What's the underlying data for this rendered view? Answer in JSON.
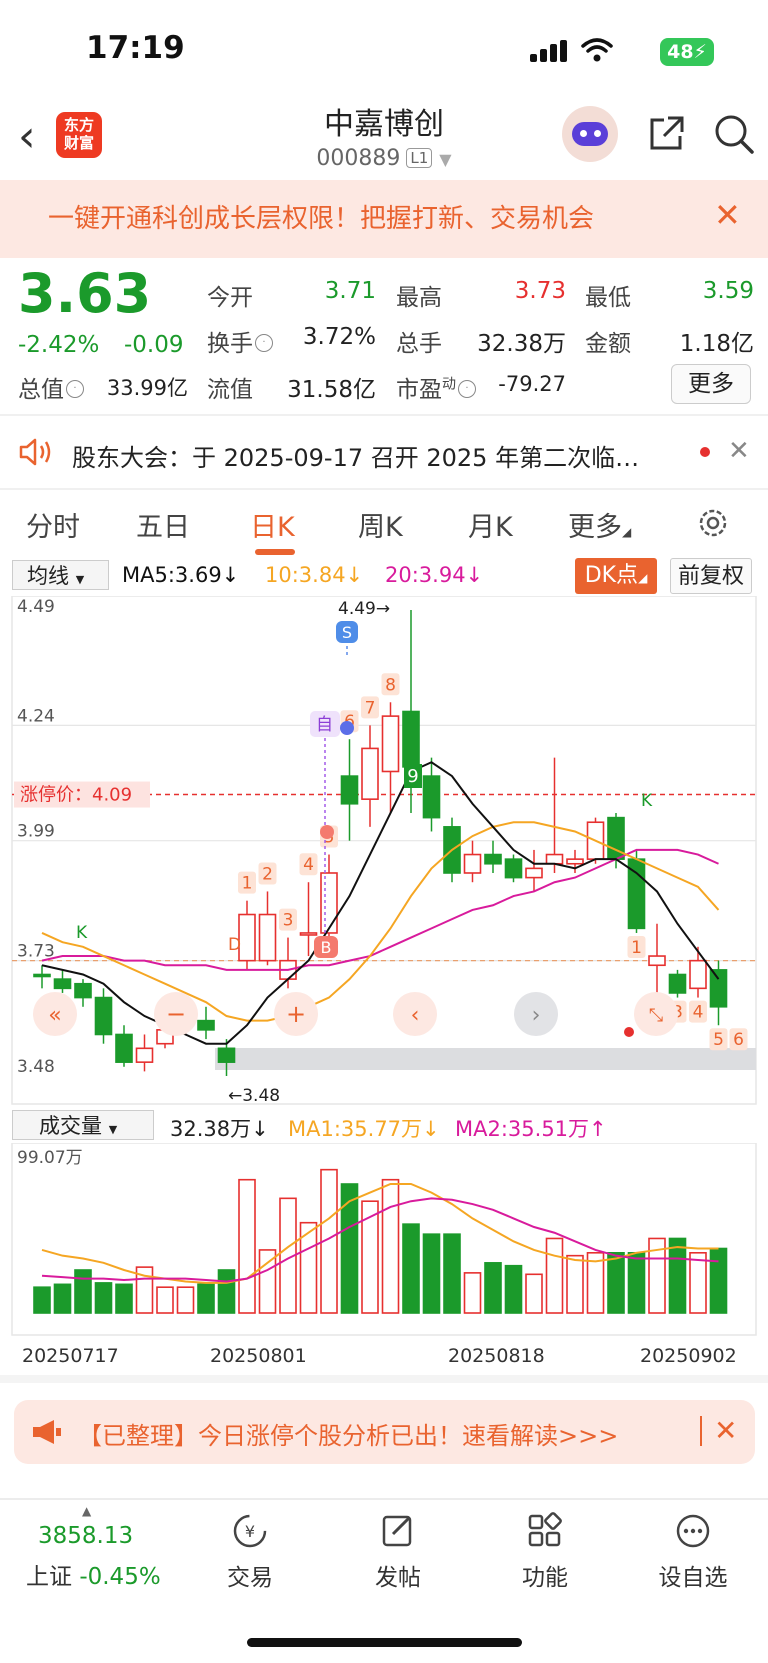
{
  "status": {
    "time": "17:19",
    "battery": "48"
  },
  "header": {
    "name": "中嘉博创",
    "code": "000889",
    "level": "L1",
    "logo": "东方\n财富"
  },
  "promo": {
    "text": "一键开通科创成长层权限！把握打新、交易机会"
  },
  "quote": {
    "price": "3.63",
    "change_pct": "-2.42%",
    "change": "-0.09",
    "open_label": "今开",
    "open": "3.71",
    "high_label": "最高",
    "high": "3.73",
    "low_label": "最低",
    "low": "3.59",
    "turnover_label": "换手",
    "turnover": "3.72%",
    "volume_label": "总手",
    "volume": "32.38万",
    "amount_label": "金额",
    "amount": "1.18亿",
    "mktcap_label": "总值",
    "mktcap": "33.99亿",
    "float_label": "流值",
    "float": "31.58亿",
    "pe_label": "市盈",
    "pe_sup": "动",
    "pe": "-79.27",
    "more": "更多"
  },
  "notice": {
    "text": "股东大会：于 2025-09-17 召开 2025 年第二次临…"
  },
  "tabs": [
    "分时",
    "五日",
    "日K",
    "周K",
    "月K",
    "更多"
  ],
  "chart_toolbar": {
    "ma_select": "均线",
    "ma5": "MA5:3.69↓",
    "ma10": "10:3.84↓",
    "ma20": "20:3.94↓",
    "dk": "DK点",
    "adjust": "前复权"
  },
  "chart_labels": {
    "y_ticks": [
      "4.49",
      "4.24",
      "3.99",
      "3.73",
      "3.48"
    ],
    "limit_label": "涨停价：4.09",
    "high_mark": "4.49→",
    "low_mark": "←3.48",
    "signal_s": "S",
    "signal_b": "B",
    "signal_d": "D",
    "signal_k": "K",
    "signal_zi": "自",
    "tag_9": "9"
  },
  "volume_toolbar": {
    "select": "成交量",
    "vol": "32.38万↓",
    "ma1": "MA1:35.77万↓",
    "ma2": "MA2:35.51万↑",
    "max": "99.07万"
  },
  "x_dates": [
    "20250717",
    "20250801",
    "20250818",
    "20250902"
  ],
  "chart_data": {
    "type": "candlestick",
    "ylim": [
      3.48,
      4.49
    ],
    "limit_price": 4.09,
    "candles": [
      {
        "o": 3.7,
        "c": 3.7,
        "h": 3.72,
        "l": 3.67,
        "up": false
      },
      {
        "o": 3.69,
        "c": 3.67,
        "h": 3.71,
        "l": 3.66,
        "up": false
      },
      {
        "o": 3.68,
        "c": 3.65,
        "h": 3.69,
        "l": 3.63,
        "up": false
      },
      {
        "o": 3.65,
        "c": 3.57,
        "h": 3.67,
        "l": 3.55,
        "up": false
      },
      {
        "o": 3.57,
        "c": 3.51,
        "h": 3.59,
        "l": 3.5,
        "up": false
      },
      {
        "o": 3.51,
        "c": 3.54,
        "h": 3.57,
        "l": 3.49,
        "up": true
      },
      {
        "o": 3.55,
        "c": 3.58,
        "h": 3.63,
        "l": 3.54,
        "up": true
      },
      {
        "o": 3.59,
        "c": 3.62,
        "h": 3.65,
        "l": 3.57,
        "up": true
      },
      {
        "o": 3.6,
        "c": 3.58,
        "h": 3.63,
        "l": 3.56,
        "up": false
      },
      {
        "o": 3.54,
        "c": 3.51,
        "h": 3.56,
        "l": 3.48,
        "up": false
      },
      {
        "o": 3.73,
        "c": 3.83,
        "h": 3.86,
        "l": 3.71,
        "up": true
      },
      {
        "o": 3.73,
        "c": 3.83,
        "h": 3.88,
        "l": 3.72,
        "up": true
      },
      {
        "o": 3.69,
        "c": 3.73,
        "h": 3.78,
        "l": 3.67,
        "up": true
      },
      {
        "o": 3.79,
        "c": 3.79,
        "h": 3.9,
        "l": 3.74,
        "up": true
      },
      {
        "o": 3.79,
        "c": 3.92,
        "h": 3.96,
        "l": 3.74,
        "up": true
      },
      {
        "o": 4.07,
        "c": 4.13,
        "h": 4.21,
        "l": 3.99,
        "up": false
      },
      {
        "o": 4.08,
        "c": 4.19,
        "h": 4.24,
        "l": 4.02,
        "up": true
      },
      {
        "o": 4.14,
        "c": 4.26,
        "h": 4.29,
        "l": 4.05,
        "up": true
      },
      {
        "o": 4.27,
        "c": 4.15,
        "h": 4.49,
        "l": 4.05,
        "up": false
      },
      {
        "o": 4.13,
        "c": 4.04,
        "h": 4.17,
        "l": 4.01,
        "up": false
      },
      {
        "o": 4.02,
        "c": 3.92,
        "h": 4.04,
        "l": 3.9,
        "up": false
      },
      {
        "o": 3.92,
        "c": 3.96,
        "h": 3.99,
        "l": 3.9,
        "up": true
      },
      {
        "o": 3.96,
        "c": 3.94,
        "h": 3.99,
        "l": 3.92,
        "up": false
      },
      {
        "o": 3.95,
        "c": 3.91,
        "h": 3.96,
        "l": 3.9,
        "up": false
      },
      {
        "o": 3.91,
        "c": 3.93,
        "h": 3.97,
        "l": 3.88,
        "up": true
      },
      {
        "o": 3.94,
        "c": 3.96,
        "h": 4.17,
        "l": 3.92,
        "up": true
      },
      {
        "o": 3.94,
        "c": 3.95,
        "h": 3.97,
        "l": 3.92,
        "up": true
      },
      {
        "o": 3.95,
        "c": 4.03,
        "h": 4.04,
        "l": 3.94,
        "up": true
      },
      {
        "o": 4.04,
        "c": 3.95,
        "h": 4.05,
        "l": 3.93,
        "up": false
      },
      {
        "o": 3.95,
        "c": 3.8,
        "h": 3.97,
        "l": 3.79,
        "up": false
      },
      {
        "o": 3.72,
        "c": 3.74,
        "h": 3.81,
        "l": 3.64,
        "up": true
      },
      {
        "o": 3.7,
        "c": 3.66,
        "h": 3.71,
        "l": 3.65,
        "up": false
      },
      {
        "o": 3.67,
        "c": 3.73,
        "h": 3.76,
        "l": 3.65,
        "up": true
      },
      {
        "o": 3.71,
        "c": 3.63,
        "h": 3.73,
        "l": 3.59,
        "up": false
      }
    ],
    "ma5": [
      3.72,
      3.71,
      3.7,
      3.68,
      3.64,
      3.61,
      3.59,
      3.57,
      3.55,
      3.55,
      3.59,
      3.65,
      3.69,
      3.73,
      3.8,
      3.87,
      3.96,
      4.05,
      4.14,
      4.16,
      4.13,
      4.07,
      4.02,
      3.97,
      3.94,
      3.94,
      3.93,
      3.95,
      3.95,
      3.92,
      3.88,
      3.81,
      3.75,
      3.69
    ],
    "ma10": [
      3.79,
      3.77,
      3.76,
      3.74,
      3.72,
      3.7,
      3.68,
      3.66,
      3.64,
      3.61,
      3.6,
      3.6,
      3.61,
      3.63,
      3.65,
      3.69,
      3.74,
      3.8,
      3.87,
      3.93,
      3.97,
      4.0,
      4.02,
      4.03,
      4.03,
      4.02,
      4.01,
      3.99,
      3.97,
      3.95,
      3.93,
      3.91,
      3.89,
      3.84
    ],
    "ma20": [
      3.73,
      3.74,
      3.74,
      3.74,
      3.73,
      3.73,
      3.72,
      3.72,
      3.72,
      3.71,
      3.71,
      3.71,
      3.71,
      3.72,
      3.72,
      3.73,
      3.74,
      3.76,
      3.78,
      3.8,
      3.82,
      3.84,
      3.85,
      3.87,
      3.88,
      3.9,
      3.91,
      3.93,
      3.95,
      3.97,
      3.97,
      3.97,
      3.96,
      3.94
    ],
    "volume_max": 99.07,
    "volumes": [
      18,
      20,
      30,
      21,
      20,
      32,
      18,
      18,
      20,
      30,
      93,
      44,
      80,
      63,
      100,
      90,
      78,
      93,
      62,
      55,
      55,
      28,
      35,
      33,
      27,
      52,
      40,
      42,
      42,
      42,
      52,
      52,
      42,
      45
    ],
    "vol_ma1": [
      44,
      40,
      38,
      35,
      30,
      26,
      24,
      22,
      21,
      21,
      24,
      35,
      46,
      56,
      66,
      78,
      84,
      90,
      90,
      84,
      76,
      66,
      58,
      50,
      44,
      40,
      37,
      36,
      38,
      42,
      44,
      46,
      45,
      45
    ],
    "vol_ma2": [
      26,
      25,
      24,
      24,
      23,
      24,
      24,
      24,
      23,
      22,
      24,
      30,
      38,
      45,
      52,
      60,
      67,
      74,
      78,
      80,
      79,
      76,
      72,
      66,
      60,
      56,
      50,
      44,
      40,
      38,
      38,
      38,
      37,
      36
    ]
  },
  "ad": {
    "text": "【已整理】今日涨停个股分析已出！速看解读>>>"
  },
  "bottom_nav": {
    "index_value": "3858.13",
    "index_name": "上证",
    "index_change": "-0.45%",
    "trade": "交易",
    "post": "发帖",
    "func": "功能",
    "watch": "设自选"
  },
  "colors": {
    "up": "#e6302f",
    "down": "#1b9a2b",
    "accent": "#e9632f",
    "ma5": "#111111",
    "ma10": "#f5a623",
    "ma20": "#d81b9c"
  }
}
